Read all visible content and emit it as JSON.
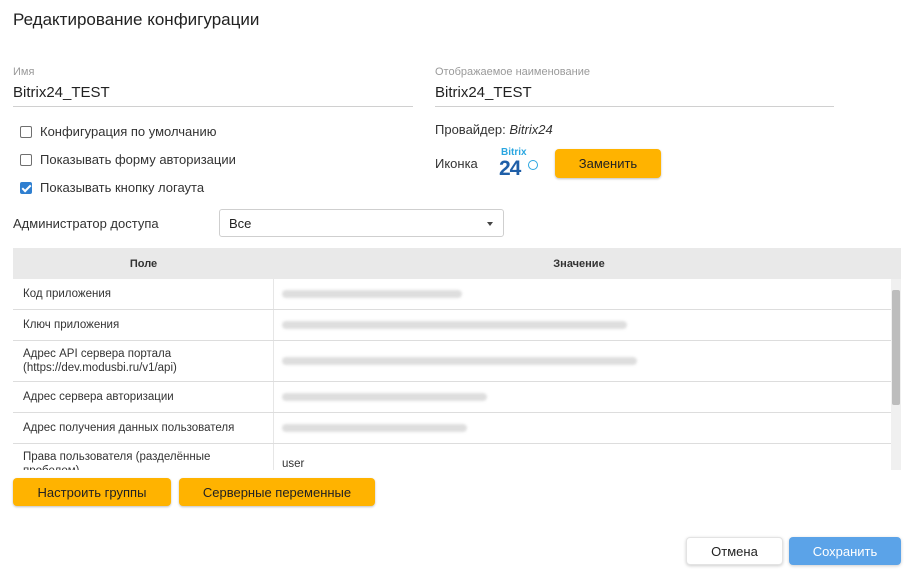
{
  "dialog": {
    "title": "Редактирование конфигурации"
  },
  "name_field": {
    "label": "Имя",
    "value": "Bitrix24_TEST"
  },
  "display_name_field": {
    "label": "Отображаемое наименование",
    "value": "Bitrix24_TEST"
  },
  "checkboxes": [
    {
      "label": "Конфигурация по умолчанию",
      "checked": false
    },
    {
      "label": "Показывать форму авторизации",
      "checked": false
    },
    {
      "label": "Показывать кнопку логаута",
      "checked": true
    }
  ],
  "provider": {
    "label": "Провайдер:",
    "value": "Bitrix24"
  },
  "icon": {
    "label": "Иконка",
    "logo_top": "Bitrix",
    "logo_main": "24",
    "replace_label": "Заменить"
  },
  "admin": {
    "label": "Администратор доступа",
    "selected": "Все"
  },
  "table": {
    "headers": [
      "Поле",
      "Значение"
    ],
    "rows": [
      {
        "field": "Код приложения",
        "value": ""
      },
      {
        "field": "Ключ приложения",
        "value": ""
      },
      {
        "field": "Адрес API сервера портала (https://dev.modusbi.ru/v1/api)",
        "value": ""
      },
      {
        "field": "Адрес сервера авторизации",
        "value": ""
      },
      {
        "field": "Адрес получения данных пользователя",
        "value": ""
      },
      {
        "field": "Права пользователя (разделённые пробелом)",
        "value": "user"
      }
    ]
  },
  "buttons": {
    "configure_groups": "Настроить группы",
    "server_variables": "Серверные переменные",
    "cancel": "Отмена",
    "save": "Сохранить"
  },
  "colors": {
    "accent_orange": "#ffb300",
    "save_blue": "#5ba3e8",
    "checkbox_blue": "#2f7fd0"
  }
}
